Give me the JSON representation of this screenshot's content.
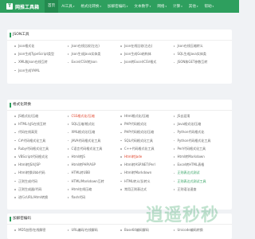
{
  "app": {
    "logo_text": "网推工具箱",
    "logo_mark": "T"
  },
  "nav": [
    {
      "label": "首页",
      "active": true,
      "caret": false
    },
    {
      "label": "AI工具",
      "caret": true
    },
    {
      "label": "格式化转换",
      "caret": true
    },
    {
      "label": "加解密编码",
      "caret": true
    },
    {
      "label": "文本数字",
      "caret": true
    },
    {
      "label": "网络",
      "caret": true
    },
    {
      "label": "计算",
      "caret": true
    },
    {
      "label": "其他",
      "caret": true
    },
    {
      "label": "帮助",
      "caret": true
    }
  ],
  "sections": [
    {
      "title": "JSON工具",
      "items": [
        {
          "label": "Json格式化"
        },
        {
          "label": "Json在线比较(左右)"
        },
        {
          "label": "Json在线比较(左右)"
        },
        {
          "label": "Json在线压缩转义"
        },
        {
          "label": "Json生成TypeScript类型"
        },
        {
          "label": "Json生成Java实体类"
        },
        {
          "label": "Json生成Go结构体"
        },
        {
          "label": "SQL生成Java实体类"
        },
        {
          "label": "XML和Json在线互转"
        },
        {
          "label": "Excel/CSV转Json"
        },
        {
          "label": "Json转Excel/CSV格式"
        },
        {
          "label": "JSON和GET参数互转"
        },
        {
          "label": "Json生成YAML"
        }
      ]
    },
    {
      "title": "格式化转换",
      "items": [
        {
          "label": "JS格式化/压缩"
        },
        {
          "label": "CSS格式化/压缩",
          "color": "red"
        },
        {
          "label": "Html格式化/压缩"
        },
        {
          "label": "JS去混淆"
        },
        {
          "label": "HTML与JS在线互转"
        },
        {
          "label": "SQL压缩/格式化"
        },
        {
          "label": "PHP代码格式化"
        },
        {
          "label": "Java格式化/压缩"
        },
        {
          "label": "代码在线高亮"
        },
        {
          "label": "XML格式化/压缩"
        },
        {
          "label": "PHP代码格式化/压缩"
        },
        {
          "label": "Python代码格式化"
        },
        {
          "label": "C#代码格式化工具"
        },
        {
          "label": "JAVA代码格式化工具"
        },
        {
          "label": "SQL代码格式化工具"
        },
        {
          "label": "Python代码格式化工具"
        },
        {
          "label": "Ruby代码格式化工具"
        },
        {
          "label": "C语言代码格式化工具"
        },
        {
          "label": "C++代码格式化工具"
        },
        {
          "label": "Perl代码格式化工具"
        },
        {
          "label": "VBScript代码格式化"
        },
        {
          "label": "Html转JS"
        },
        {
          "label": "Html转Jade",
          "color": "red"
        },
        {
          "label": "Html转Markdown"
        },
        {
          "label": "Html转JSX/JSP"
        },
        {
          "label": "Html转PHP/ASP"
        },
        {
          "label": "Html转ASP.NET/Perl"
        },
        {
          "label": "Excel转HTML表格"
        },
        {
          "label": "Html转换Ubb代码"
        },
        {
          "label": "HTML转UBB"
        },
        {
          "label": "Html转Markdown"
        },
        {
          "label": "正则表达式测试",
          "color": "green"
        },
        {
          "label": "正则生成代码"
        },
        {
          "label": "HTML/Markdown互转"
        },
        {
          "label": "HTML转义/反转义"
        },
        {
          "label": "正则表达式测试工具",
          "color": "green"
        },
        {
          "label": "正则生成器/代码"
        },
        {
          "label": "Html在线压缩"
        },
        {
          "label": "常用正则表达式"
        },
        {
          "label": "正则语法速查"
        },
        {
          "label": "进行cURL/Html转换"
        },
        {
          "label": "flash代码"
        }
      ]
    },
    {
      "title": "加解密编码",
      "items": [
        {
          "label": "MD5加密/在线解密"
        },
        {
          "label": "URL编码/在线解码"
        },
        {
          "label": "Base64编码解码"
        },
        {
          "label": "Unicode编码转换"
        }
      ]
    }
  ],
  "watermark": "逍遥秒秒"
}
